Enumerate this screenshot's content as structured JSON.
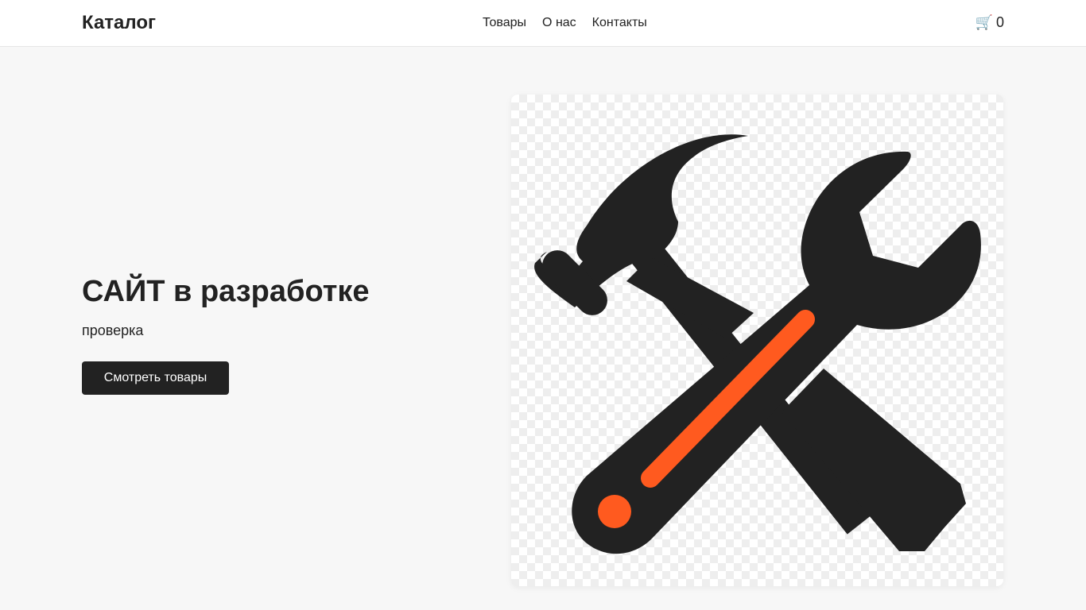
{
  "header": {
    "logo": "Каталог",
    "nav": [
      {
        "label": "Товары"
      },
      {
        "label": "О нас"
      },
      {
        "label": "Контакты"
      }
    ],
    "cart": {
      "icon": "cart-icon",
      "glyph": "🛒",
      "count": "0"
    }
  },
  "hero": {
    "title": "САЙТ в разработке",
    "subtitle": "проверка",
    "button_label": "Смотреть товары",
    "image": {
      "icon": "hammer-and-wrench-icon"
    }
  },
  "colors": {
    "dark": "#222222",
    "accent": "#ff5a1f",
    "background": "#f7f7f7"
  }
}
